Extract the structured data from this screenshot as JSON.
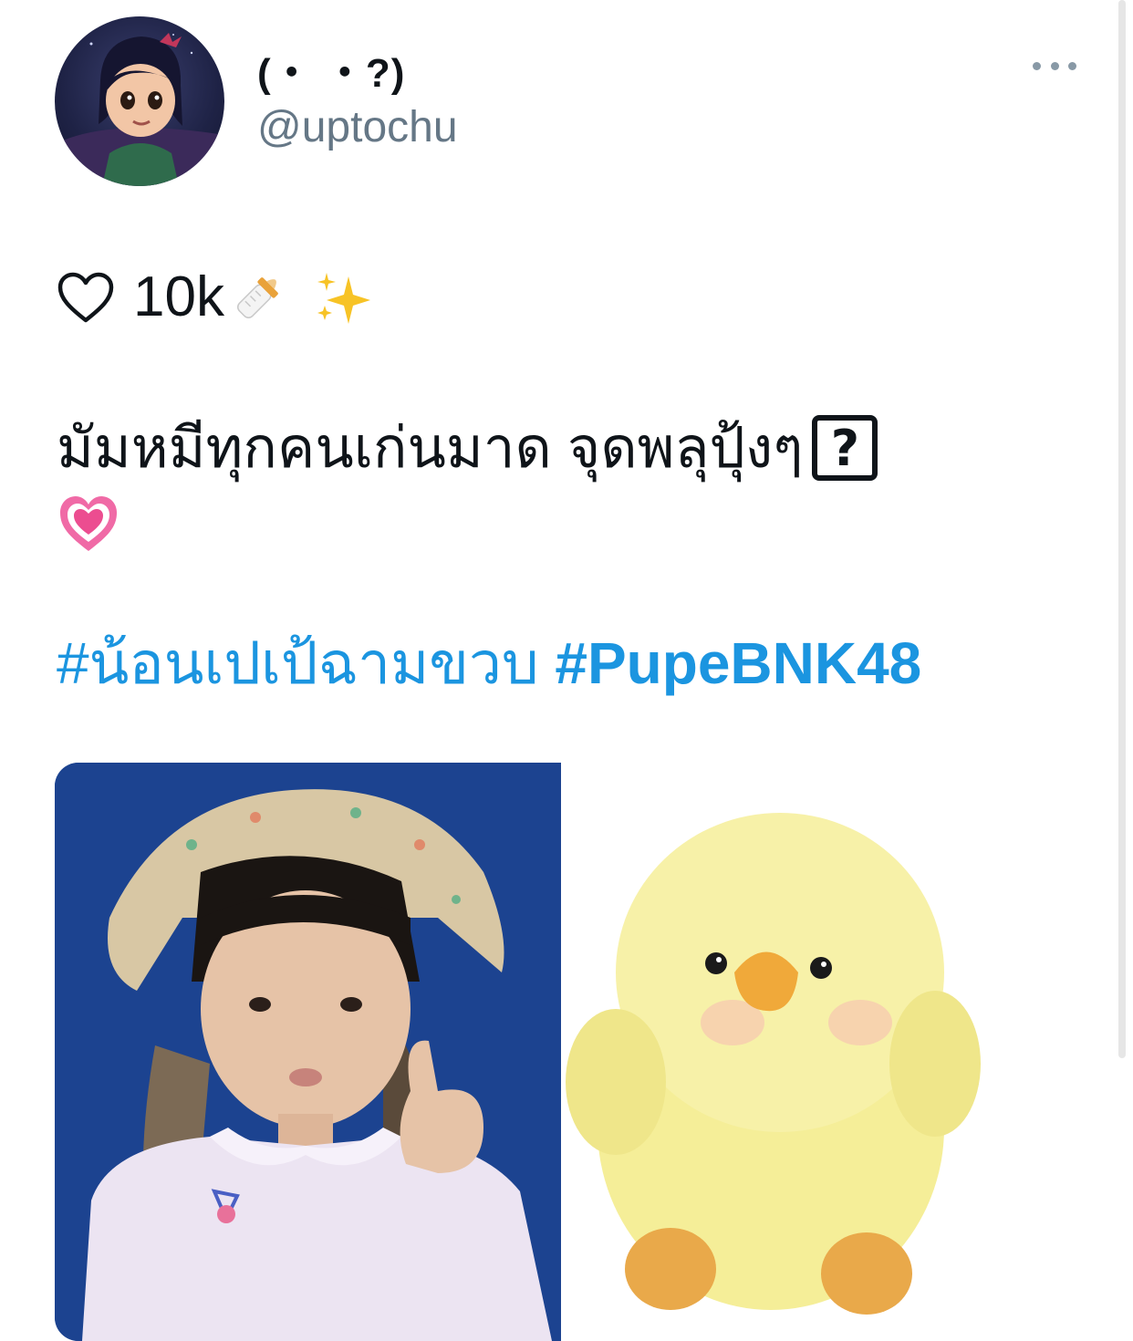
{
  "tweet": {
    "author": {
      "display_name": "(・ ・?)",
      "handle": "@uptochu",
      "avatar": "cartoon-girl-avatar"
    },
    "more_menu": "more-options-icon",
    "text": {
      "line1_count": "10k",
      "line1_icons": [
        "outline-heart-icon",
        "baby-bottle-emoji",
        "sparkles-emoji"
      ],
      "line2": "มัมหมีทุกคนเก่นมาด จุดพลุปุ้งๆ",
      "line2_icon": "?",
      "line3_icon": "growing-heart-emoji"
    },
    "hashtags": [
      "#น้อนเปเป้ฉามขวบ",
      "#PupeBNK48"
    ],
    "media": [
      {
        "alt": "child-thumbs-up-photo"
      },
      {
        "alt": "yellow-chick-plush-photo"
      }
    ]
  },
  "colors": {
    "link": "#1b95e0",
    "secondary_text": "#657786",
    "photo_background": "#1c4390"
  }
}
